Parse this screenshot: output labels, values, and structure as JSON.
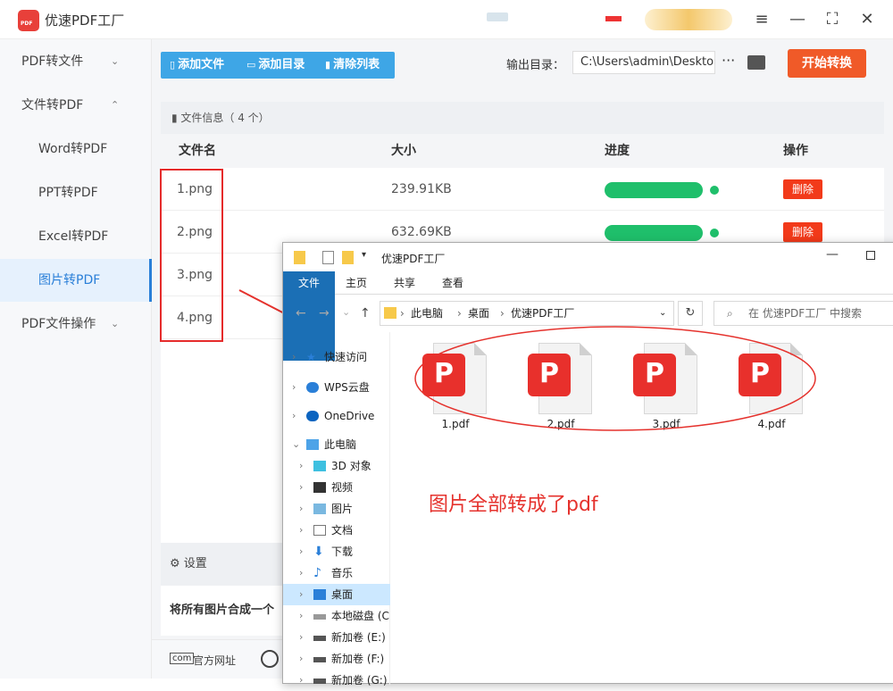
{
  "app": {
    "title": "优速PDF工厂",
    "window_controls": [
      "≡",
      "—",
      "⛶",
      "✕"
    ]
  },
  "sidebar": {
    "items": [
      {
        "label": "PDF转文件",
        "chevron": "⌄"
      },
      {
        "label": "文件转PDF",
        "chevron": "⌃"
      },
      {
        "label": "Word转PDF"
      },
      {
        "label": "PPT转PDF"
      },
      {
        "label": "Excel转PDF"
      },
      {
        "label": "图片转PDF"
      },
      {
        "label": "PDF文件操作",
        "chevron": "⌄"
      }
    ]
  },
  "toolbar": {
    "add_file": "添加文件",
    "add_dir": "添加目录",
    "clear_list": "清除列表",
    "output_label": "输出目录：",
    "output_path": "C:\\Users\\admin\\Desktop",
    "more": "···",
    "start": "开始转换"
  },
  "table": {
    "info": "文件信息（ 4 个）",
    "headers": {
      "name": "文件名",
      "size": "大小",
      "progress": "进度",
      "action": "操作"
    },
    "rows": [
      {
        "name": "1.png",
        "size": "239.91KB",
        "progress": 1.0,
        "action": "删除"
      },
      {
        "name": "2.png",
        "size": "632.69KB",
        "progress": 1.0,
        "action": "删除"
      },
      {
        "name": "3.png"
      },
      {
        "name": "4.png"
      }
    ]
  },
  "settings": {
    "title": "设置",
    "merge_label": "将所有图片合成一个"
  },
  "footer": {
    "website": "官方网址"
  },
  "explorer": {
    "title": "优速PDF工厂",
    "ribbon_tabs": [
      "文件",
      "主页",
      "共享",
      "查看"
    ],
    "breadcrumb": [
      "此电脑",
      "桌面",
      "优速PDF工厂"
    ],
    "search_placeholder": "在 优速PDF工厂 中搜索",
    "tree": [
      {
        "label": "快速访问"
      },
      {
        "label": "WPS云盘"
      },
      {
        "label": "OneDrive"
      },
      {
        "label": "此电脑"
      },
      {
        "label": "3D 对象"
      },
      {
        "label": "视频"
      },
      {
        "label": "图片"
      },
      {
        "label": "文档"
      },
      {
        "label": "下载"
      },
      {
        "label": "音乐"
      },
      {
        "label": "桌面"
      },
      {
        "label": "本地磁盘 (C:)"
      },
      {
        "label": "新加卷 (E:)"
      },
      {
        "label": "新加卷 (F:)"
      },
      {
        "label": "新加卷 (G:)"
      }
    ],
    "files": [
      "1.pdf",
      "2.pdf",
      "3.pdf",
      "4.pdf"
    ]
  },
  "annotation": "图片全部转成了pdf",
  "colors": {
    "accent": "#3ea6e6",
    "start": "#f05a28",
    "progress": "#1fbf6b",
    "delete": "#f23a1a",
    "annotation": "#e5322d",
    "ribbon_file": "#1b6fb5"
  }
}
